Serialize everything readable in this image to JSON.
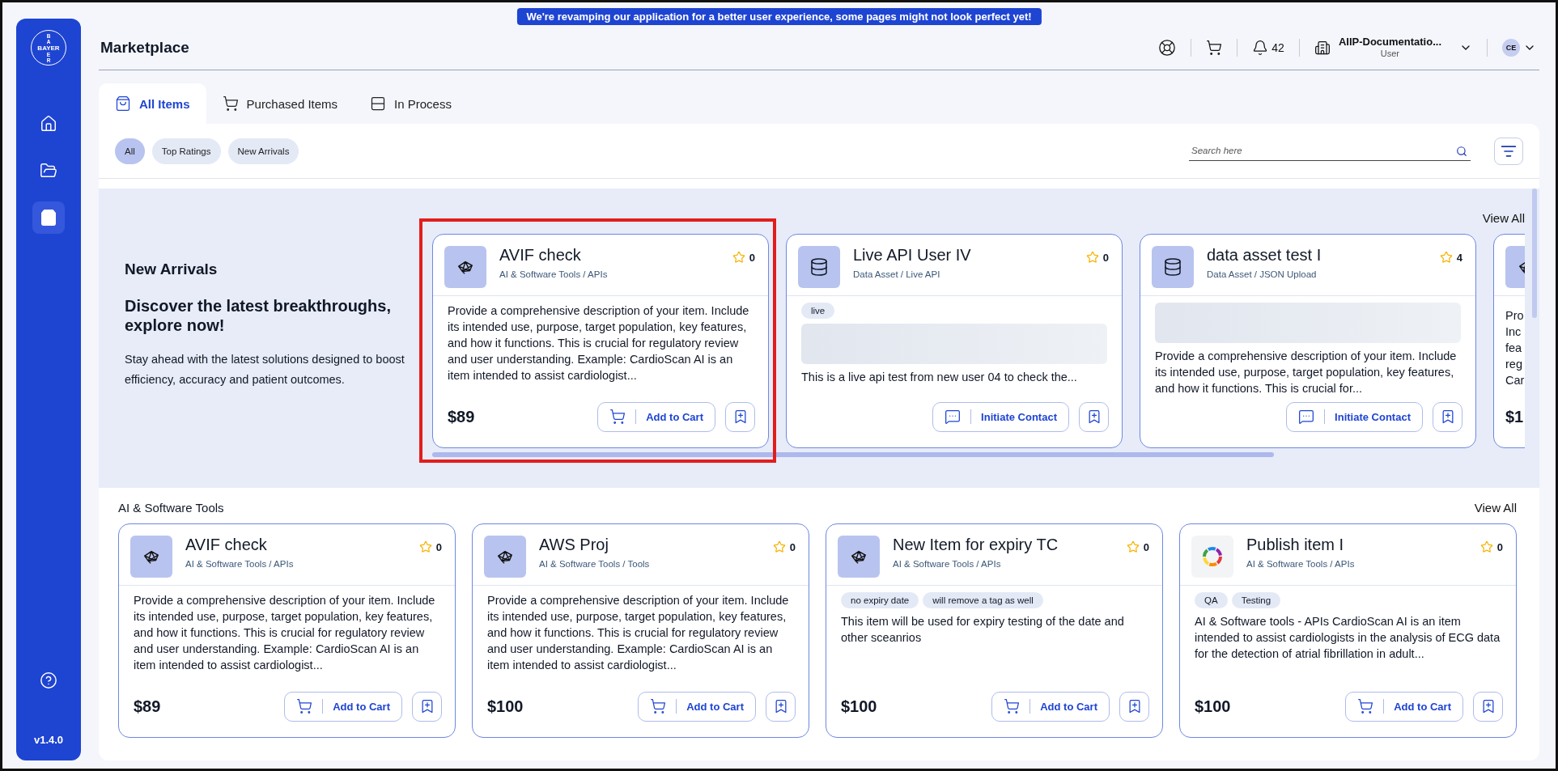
{
  "banner": "We're revamping our application for a better user experience, some pages might not look perfect yet!",
  "sidebar": {
    "logo": {
      "top": [
        "B",
        "A"
      ],
      "middle": "BAYER",
      "bottom": [
        "E",
        "R"
      ]
    },
    "items": [
      {
        "kind": "home",
        "selected": false
      },
      {
        "kind": "folder",
        "selected": false
      },
      {
        "kind": "bag",
        "selected": true
      }
    ],
    "version": "v1.4.0"
  },
  "header": {
    "title": "Marketplace",
    "notifications": "42",
    "account": {
      "name": "AIIP-Documentatio...",
      "role": "User"
    },
    "avatar": "CE"
  },
  "tabs": [
    {
      "label": "All Items",
      "kind": "bag",
      "selected": true
    },
    {
      "label": "Purchased Items",
      "kind": "cart",
      "selected": false
    },
    {
      "label": "In Process",
      "kind": "rows",
      "selected": false
    }
  ],
  "chips": [
    {
      "label": "All",
      "selected": true
    },
    {
      "label": "Top Ratings",
      "selected": false
    },
    {
      "label": "New Arrivals",
      "selected": false
    }
  ],
  "search": {
    "placeholder": "Search here"
  },
  "new_arrivals": {
    "title": "New Arrivals",
    "headline": "Discover the latest breakthroughs, explore now!",
    "text": "Stay ahead with the latest solutions designed to boost efficiency, accuracy and patient outcomes.",
    "view_all": "View All",
    "cards": [
      {
        "title": "AVIF check",
        "category": "AI & Software Tools / APIs",
        "rating": "0",
        "kind": "network",
        "highlighted": true,
        "media_placeholder": false,
        "description": "Provide a comprehensive description of your item. Include its intended use, purpose, target population, key features, and how it functions. This is crucial for regulatory review and user understanding. Example: CardioScan AI is an item intended to assist cardiologist...",
        "price": "$89",
        "action": {
          "kind": "cart",
          "label": "Add to Cart"
        }
      },
      {
        "title": "Live API User IV",
        "category": "Data Asset / Live API",
        "rating": "0",
        "kind": "database",
        "highlighted": false,
        "tags": [
          "live"
        ],
        "media_placeholder": true,
        "description": "This is a live api test from new user 04 to check the...",
        "action": {
          "kind": "contact",
          "label": "Initiate Contact"
        }
      },
      {
        "title": "data asset test I",
        "category": "Data Asset / JSON Upload",
        "rating": "4",
        "kind": "database",
        "highlighted": false,
        "media_placeholder": true,
        "description": "Provide a comprehensive description of your item. Include its intended use, purpose, target population, key features, and how it functions. This is crucial for...",
        "action": {
          "kind": "contact",
          "label": "Initiate Contact"
        }
      }
    ],
    "partial_card": {
      "kind": "network",
      "lines": [
        "Pro",
        "Inc",
        "fea",
        "reg",
        "Car"
      ],
      "price": "$1"
    }
  },
  "sections": [
    {
      "title": "AI & Software Tools",
      "view_all": "View All",
      "cards": [
        {
          "title": "AVIF check",
          "category": "AI & Software Tools / APIs",
          "rating": "0",
          "kind": "network",
          "highlighted": false,
          "media_placeholder": false,
          "description": "Provide a comprehensive description of your item. Include its intended use, purpose, target population, key features, and how it functions. This is crucial for regulatory review and user understanding. Example: CardioScan AI is an item intended to assist cardiologist...",
          "price": "$89",
          "action": {
            "kind": "cart",
            "label": "Add to Cart"
          }
        },
        {
          "title": "AWS Proj",
          "category": "AI & Software Tools / Tools",
          "rating": "0",
          "kind": "network",
          "highlighted": false,
          "media_placeholder": false,
          "description": "Provide a comprehensive description of your item. Include its intended use, purpose, target population, key features, and how it functions. This is crucial for regulatory review and user understanding. Example: CardioScan AI is an item intended to assist cardiologist...",
          "price": "$100",
          "action": {
            "kind": "cart",
            "label": "Add to Cart"
          }
        },
        {
          "title": "New Item for expiry TC",
          "category": "AI & Software Tools / APIs",
          "rating": "0",
          "kind": "network",
          "highlighted": false,
          "tags": [
            "no expiry date",
            "will remove a tag as well"
          ],
          "media_placeholder": false,
          "description": "This item will be used for expiry testing of the date and other sceanrios",
          "price": "$100",
          "action": {
            "kind": "cart",
            "label": "Add to Cart"
          }
        },
        {
          "title": "Publish item I",
          "category": "AI & Software Tools / APIs",
          "rating": "0",
          "kind": "logo",
          "highlighted": false,
          "tags": [
            "QA",
            "Testing"
          ],
          "media_placeholder": false,
          "description": "AI & Software tools - APIs CardioScan AI is an item intended to assist cardiologists in the analysis of ECG data for the detection of atrial fibrillation in adult...",
          "price": "$100",
          "action": {
            "kind": "cart",
            "label": "Add to Cart"
          }
        }
      ]
    }
  ]
}
